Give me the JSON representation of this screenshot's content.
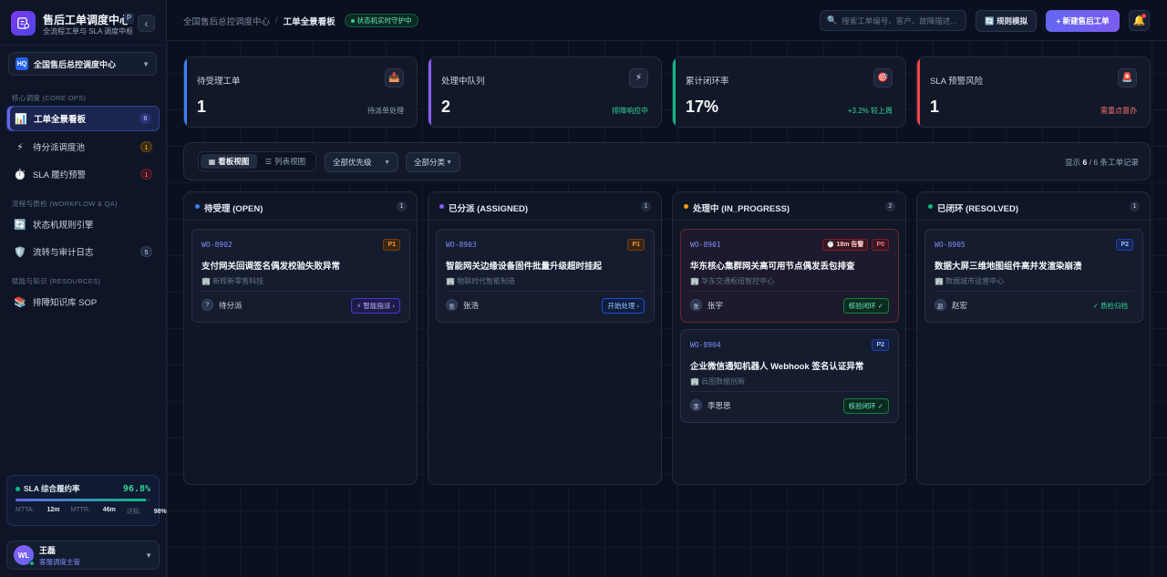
{
  "brand": {
    "title": "售后工单调度中心",
    "badge": "P",
    "subtitle": "全流程工单与 SLA 调度中枢"
  },
  "org": {
    "chip": "HQ",
    "name": "全国售后总控调度中心"
  },
  "nav": {
    "sections": {
      "core": "核心调度 (CORE OPS)",
      "workflow": "流程与质检 (WORKFLOW & QA)",
      "resources": "赋能与知识 (RESOURCES)"
    },
    "items": [
      {
        "label": "工单全景看板",
        "count": "6",
        "icon": "📊"
      },
      {
        "label": "待分派调度池",
        "count": "1",
        "icon": "⚡"
      },
      {
        "label": "SLA 履约预警",
        "count": "1",
        "icon": "⏱️"
      },
      {
        "label": "状态机规则引擎",
        "count": "",
        "icon": "🔄"
      },
      {
        "label": "流转与审计日志",
        "count": "5",
        "icon": "🛡️"
      },
      {
        "label": "排障知识库 SOP",
        "count": "",
        "icon": "📚"
      }
    ]
  },
  "sla": {
    "title": "SLA 综合履约率",
    "value": "96.8%",
    "progress": 0.968,
    "mtta_label": "MTTA:",
    "mtta": "12m",
    "mttr_label": "MTTR:",
    "mttr": "46m",
    "rate_label": "达标:",
    "rate": "98%"
  },
  "user": {
    "initials": "WL",
    "name": "王磊",
    "role": "客服调度主管"
  },
  "topbar": {
    "crumb_root": "全国售后总控调度中心",
    "crumb_sep": "/",
    "crumb_current": "工单全景看板",
    "live_badge": "状态机实时守护中",
    "search_placeholder": "搜索工单编号、客户、故障描述...",
    "sim_button": "🔄 规则模拟",
    "new_button": "+ 新建售后工单",
    "bell_icon": "🔔"
  },
  "kpis": [
    {
      "label": "待受理工单",
      "value": "1",
      "note": "待派单处理",
      "icon": "📥",
      "accent": "#3b82f6",
      "note_color": "#94a3b8"
    },
    {
      "label": "处理中队列",
      "value": "2",
      "note": "排障响应中",
      "icon": "⚡",
      "accent": "#8b5cf6",
      "note_color": "#34d399"
    },
    {
      "label": "累计闭环率",
      "value": "17%",
      "note": "+3.2% 较上周",
      "icon": "🎯",
      "accent": "#10b981",
      "note_color": "#34d399"
    },
    {
      "label": "SLA 预警风险",
      "value": "1",
      "note": "需重点督办",
      "icon": "🚨",
      "accent": "#ef4444",
      "note_color": "#f87171"
    }
  ],
  "toolbar": {
    "view_board": "看板视图",
    "view_list": "列表视图",
    "priority_select": "全部优先级",
    "category_select": "全部分类",
    "count_prefix": "显示",
    "count_shown": "6",
    "count_sep": "/",
    "count_total": "6 条工单记录"
  },
  "columns": [
    {
      "title": "待受理 (OPEN)",
      "count": "1",
      "dot": "#3b82f6",
      "cards": [
        {
          "id": "WO-8902",
          "timer": "",
          "priority": "P1",
          "title": "支付网关回调签名偶发校验失败异常",
          "company": "🏢 新辉新零售科技",
          "assignee_initial": "?",
          "assignee": "待分派",
          "action": "⚡ 智能指派 ›",
          "action_style": "act-purple",
          "alert": false
        }
      ]
    },
    {
      "title": "已分派 (ASSIGNED)",
      "count": "1",
      "dot": "#8b5cf6",
      "cards": [
        {
          "id": "WO-8903",
          "timer": "",
          "priority": "P1",
          "title": "智能网关边缘设备固件批量升级超时挂起",
          "company": "🏢 物联时代智能制造",
          "assignee_initial": "张",
          "assignee": "张浩",
          "action": "开始处理 ›",
          "action_style": "act-blue",
          "alert": false
        }
      ]
    },
    {
      "title": "处理中 (IN_PROGRESS)",
      "count": "2",
      "dot": "#f59e0b",
      "cards": [
        {
          "id": "WO-8901",
          "timer": "⏱️ 18m 告警",
          "priority": "P0",
          "title": "华东核心集群网关高可用节点偶发丢包排查",
          "company": "🏢 华东交通枢纽智控中心",
          "assignee_initial": "张",
          "assignee": "张宇",
          "action": "核验闭环 ✓",
          "action_style": "act-green",
          "alert": true
        },
        {
          "id": "WO-8904",
          "timer": "",
          "priority": "P2",
          "title": "企业微信通知机器人 Webhook 签名认证异常",
          "company": "🏢 云图数据创新",
          "assignee_initial": "李",
          "assignee": "李思思",
          "action": "核验闭环 ✓",
          "action_style": "act-green",
          "alert": false
        }
      ]
    },
    {
      "title": "已闭环 (RESOLVED)",
      "count": "1",
      "dot": "#10b981",
      "cards": [
        {
          "id": "WO-8905",
          "timer": "",
          "priority": "P2",
          "title": "数据大屏三维地图组件高并发渲染崩溃",
          "company": "🏢 数据城市运营中心",
          "assignee_initial": "赵",
          "assignee": "赵宏",
          "action": "✓ 质检归档",
          "action_style": "act-plain",
          "alert": false
        }
      ]
    }
  ]
}
